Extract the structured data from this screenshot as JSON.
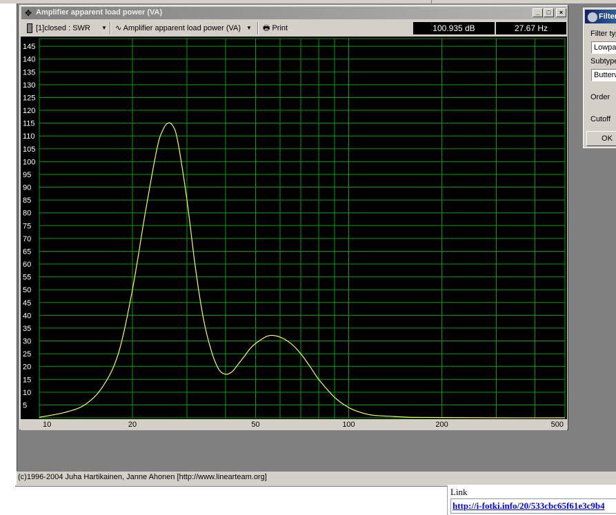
{
  "window": {
    "title": "Amplifier apparent load power (VA)",
    "minimize": "_",
    "maximize": "□",
    "close": "×"
  },
  "toolbar": {
    "measurement": "[1]closed : SWR",
    "view": "Amplifier apparent load power (VA)",
    "print": "Print",
    "readout_level": "100.935 dB",
    "readout_freq": "27.67 Hz"
  },
  "status": {
    "copyright": "(c)1996-2004 Juha Hartikainen, Janne Ahonen [http://www.linearteam.org]"
  },
  "filter_dialog": {
    "title": "Filter",
    "filter_type_label": "Filter typ",
    "filter_type_value": "Lowpa",
    "subtype_label": "Subtype",
    "subtype_value": "Butterw",
    "order_label": "Order",
    "cutoff_label": "Cutoff",
    "ok_label": "OK"
  },
  "link": {
    "label": "Link",
    "url": "http://i-fotki.info/20/533cbc65f61e3c9b4"
  },
  "colors": {
    "plot_bg": "#000000",
    "grid": "#00a000",
    "curve": "#ffff40",
    "text": "#ffffff"
  },
  "chart_data": {
    "type": "line",
    "x_scale": "log",
    "xlim": [
      10,
      500
    ],
    "ylim": [
      0,
      148
    ],
    "x_ticks": [
      10,
      20,
      50,
      100,
      200,
      500
    ],
    "y_ticks": [
      5,
      10,
      15,
      20,
      25,
      30,
      35,
      40,
      45,
      50,
      55,
      60,
      65,
      70,
      75,
      80,
      85,
      90,
      95,
      100,
      105,
      110,
      115,
      120,
      125,
      130,
      135,
      140,
      145
    ],
    "grid": true,
    "x": [
      10,
      12,
      14,
      16,
      18,
      20,
      22,
      24,
      25,
      26,
      27,
      28,
      30,
      32,
      34,
      36,
      38,
      40,
      42,
      44,
      46,
      48,
      50,
      55,
      60,
      65,
      70,
      75,
      80,
      90,
      100,
      110,
      120,
      140,
      160,
      200,
      300,
      500
    ],
    "series": [
      {
        "values": [
          0.2,
          2,
          5,
          12,
          25,
          50,
          80,
          105,
          112,
          115,
          114,
          108,
          85,
          58,
          38,
          26,
          19,
          17,
          18,
          21,
          24,
          27,
          29,
          32,
          31.5,
          29,
          25,
          20,
          15,
          8,
          4,
          2,
          1,
          0.5,
          0.2,
          0.1,
          0,
          0
        ]
      }
    ]
  }
}
